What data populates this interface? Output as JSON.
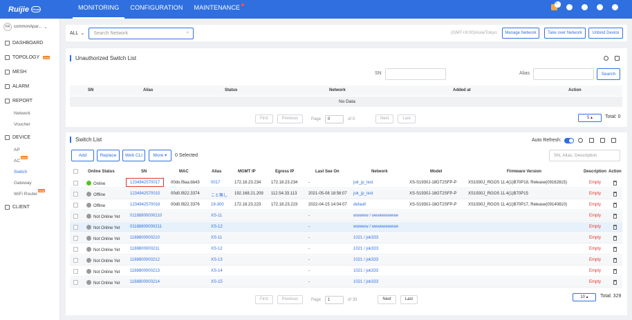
{
  "topbar": {
    "logo": "Ruijie",
    "logo_cloud": "Cloud",
    "nav": [
      "MONITORING",
      "CONFIGURATION",
      "MAINTENANCE"
    ],
    "notification_count": "5"
  },
  "sidebar": {
    "account": "commonApar...",
    "account_avatar": "FR",
    "items": {
      "dashboard": "DASHBOARD",
      "topology": "TOPOLOGY",
      "mesh": "MESH",
      "alarm": "ALARM",
      "report": "REPORT",
      "network": "Network",
      "voucher": "Voucher",
      "device": "DEVICE",
      "ap": "AP",
      "ac": "AC",
      "switch": "Switch",
      "gateway": "Gateway",
      "wifi_router": "WiFi Router",
      "client": "CLIENT"
    },
    "beta": "beta"
  },
  "filter": {
    "scope": "ALL",
    "search_placeholder": "Search Network",
    "timezone": "(GMT+9:00)Asia/Tokyo",
    "manage_network": "Manage Network",
    "take_over": "Take over Network",
    "unbind": "Unbind Device"
  },
  "unauth": {
    "title": "Unauthorized Switch List",
    "sn_label": "SN",
    "alias_label": "Alias",
    "search_btn": "Search",
    "headers": [
      "SN",
      "Alias",
      "Status",
      "Network",
      "Added at",
      "Action"
    ],
    "empty": "No Data",
    "pager": {
      "first": "First",
      "prev": "Previous",
      "page_label": "Page",
      "page": "0",
      "of": "of 0",
      "next": "Next",
      "last": "Last"
    },
    "page_size": "5",
    "total": "Total: 0"
  },
  "switches": {
    "title": "Switch List",
    "auto_refresh": "Auto Refresh:",
    "buttons": {
      "add": "Add",
      "replace": "Replace",
      "webcli": "Web CLI",
      "more": "More"
    },
    "selected": "0 Selected",
    "search_placeholder": "SN, Alias, Description",
    "headers": [
      "Online Status",
      "SN",
      "MAC",
      "Alias",
      "MGMT IP",
      "Egress IP",
      "Last See On",
      "Network",
      "Model",
      "Firmware Version",
      "Description",
      "Action"
    ],
    "rows": [
      {
        "status": "Online",
        "sn": "1234942570017",
        "mac": "00do.f8aa.bb43",
        "alias": "0017",
        "mgmt": "172.18.23.234",
        "egress": "172.18.23.234",
        "last": "-",
        "network": "jok_jp_test",
        "model": "XS-S1930J-18GT2SFP-P",
        "fw": "XS1930J_RGOS 11.4(1)B70P18, Release(09162815)",
        "desc": "Empty"
      },
      {
        "status": "Offline",
        "sn": "1234942570015",
        "mac": "00d0.f822.3374",
        "alias": "こと無し",
        "mgmt": "192.168.21.209",
        "egress": "112.54.33.113",
        "last": "2021-05-08 18:56:07",
        "network": "jok_jp_test",
        "model": "XS-S1930J-18GT2SFP-P",
        "fw": "XS1930J_RGOS 11.4(1)B70P15",
        "desc": "Empty"
      },
      {
        "status": "Offline",
        "sn": "1234942570016",
        "mac": "00d0.f822.3376",
        "alias": "19-300",
        "mgmt": "172.18.23.223",
        "egress": "172.18.23.223",
        "last": "2022-04-15 14:04:07",
        "network": "default",
        "model": "XS-S1930J-18GT2SFP-P",
        "fw": "XS1930J_RGOS 11.4(1)B70P17, Release(09140810)",
        "desc": "Empty"
      },
      {
        "status": "Not Online Yet",
        "sn": "01188800000210",
        "mac": "",
        "alias": "XS-11",
        "mgmt": "",
        "egress": "",
        "last": "-",
        "network": "wwwww / wewewewewe",
        "model": "",
        "fw": "",
        "desc": "Empty"
      },
      {
        "status": "Not Online Yet",
        "sn": "01188800000211",
        "mac": "",
        "alias": "XS-12",
        "mgmt": "",
        "egress": "",
        "last": "-",
        "network": "wwwww / wewewewewe",
        "model": "",
        "fw": "",
        "desc": "Empty"
      },
      {
        "status": "Not Online Yet",
        "sn": "1188800000210",
        "mac": "",
        "alias": "XS-11",
        "mgmt": "",
        "egress": "",
        "last": "-",
        "network": "1021 / jok333",
        "model": "",
        "fw": "",
        "desc": "Empty"
      },
      {
        "status": "Not Online Yet",
        "sn": "1188800000211",
        "mac": "",
        "alias": "XS-12",
        "mgmt": "",
        "egress": "",
        "last": "-",
        "network": "1021 / jok333",
        "model": "",
        "fw": "",
        "desc": "Empty"
      },
      {
        "status": "Not Online Yet",
        "sn": "1188800000212",
        "mac": "",
        "alias": "XS-13",
        "mgmt": "",
        "egress": "",
        "last": "-",
        "network": "1021 / jok333",
        "model": "",
        "fw": "",
        "desc": "Empty"
      },
      {
        "status": "Not Online Yet",
        "sn": "1188800000213",
        "mac": "",
        "alias": "XS-14",
        "mgmt": "",
        "egress": "",
        "last": "-",
        "network": "1021 / jok333",
        "model": "",
        "fw": "",
        "desc": "Empty"
      },
      {
        "status": "Not Online Yet",
        "sn": "1188800000214",
        "mac": "",
        "alias": "XS-15",
        "mgmt": "",
        "egress": "",
        "last": "-",
        "network": "1021 / jok333",
        "model": "",
        "fw": "",
        "desc": "Empty"
      }
    ],
    "pager": {
      "first": "First",
      "prev": "Previous",
      "page_label": "Page",
      "page": "1",
      "of": "of 33",
      "next": "Next",
      "last": "Last"
    },
    "page_size": "10",
    "total": "Total: 329"
  }
}
